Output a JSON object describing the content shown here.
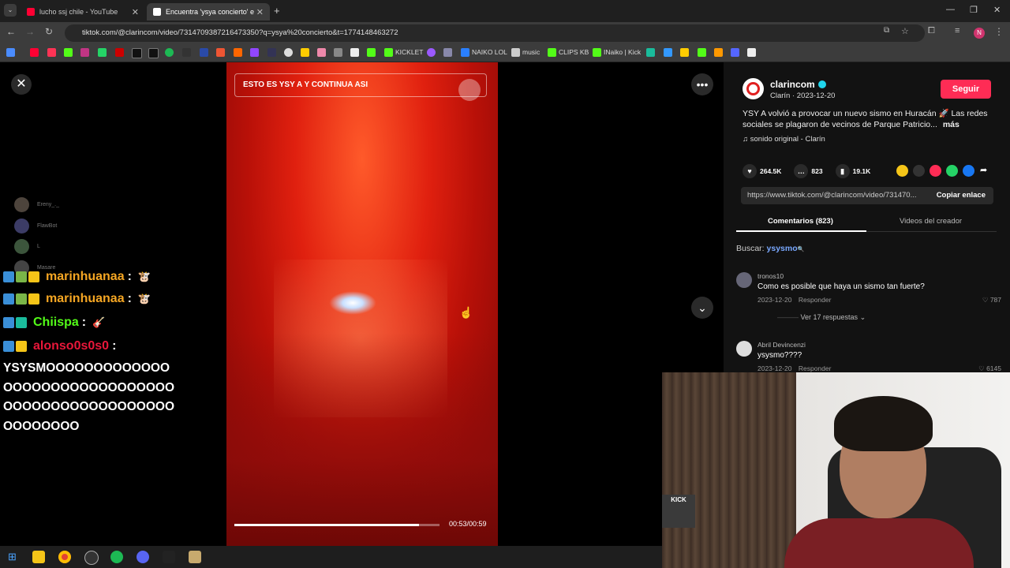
{
  "browser": {
    "tabs": [
      {
        "title": "lucho ssj chile - YouTube",
        "favicon_color": "#ff0033"
      },
      {
        "title": "Encuentra 'ysya concierto' e",
        "favicon_color": "#ffffff"
      }
    ],
    "url": "tiktok.com/@clarincom/video/7314709387216473350?q=ysya%20concierto&t=1774148463272",
    "bookmarks": [
      "KICKLET",
      "NAIKO LOL",
      "music",
      "CLIPS KB",
      "INaiko | Kick"
    ]
  },
  "stream_overlay": {
    "viewers": [
      {
        "name": "Ereny_._"
      },
      {
        "name": "FlawBot"
      },
      {
        "name": "L"
      },
      {
        "name": "Masare"
      }
    ],
    "chat": [
      {
        "user": "marinhuanaa",
        "sep": ":",
        "color": "#f5a623",
        "emote": "🐮"
      },
      {
        "user": "marinhuanaa",
        "sep": ":",
        "color": "#f5a623",
        "emote": "🐮"
      },
      {
        "user": "Chiispa",
        "sep": ":",
        "color": "#53fc18",
        "emote": "🎸"
      },
      {
        "user": "alonso0s0s0",
        "sep": ":",
        "color": "#e8173a",
        "emote": ""
      }
    ],
    "last_message": "YSYSMOOOOOOOOOOOOOOOOOOOOOOOOOOOOOOOOOOOOOOOOOOOOOOOOOOOOOOOOO"
  },
  "video": {
    "caption": "ESTO ES YSY A Y CONTINUA ASI",
    "time": "00:53/00:59",
    "progress": 0.9
  },
  "post": {
    "username": "clarincom",
    "nickname": "Clarín",
    "date": "2023-12-20",
    "follow_label": "Seguir",
    "description": "YSY A volvió a provocar un nuevo sismo en Huracán 🚀 Las redes sociales se plagaron de vecinos de Parque Patricio...",
    "more_label": "más",
    "sound": "sonido original - Clarín",
    "likes": "264.5K",
    "comments": "823",
    "saves": "19.1K",
    "link": "https://www.tiktok.com/@clarincom/video/731470...",
    "copy_label": "Copiar enlace",
    "tab_comments": "Comentarios (823)",
    "tab_creator": "Videos del creador",
    "search_prefix": "Buscar:",
    "search_term": "ysysmo"
  },
  "comments": [
    {
      "user": "tronos10",
      "text": "Como es posible que haya un sismo tan fuerte?",
      "date": "2023-12-20",
      "reply": "Responder",
      "likes": "787",
      "replies": "Ver 17 respuestas"
    },
    {
      "user": "Abril Devincenzi",
      "text": "ysysmo????",
      "date": "2023-12-20",
      "reply": "Responder",
      "likes": "6145"
    }
  ],
  "webcam": {
    "overlay_text": "KICK"
  },
  "colors": {
    "accent": "#fe2c55",
    "panel_bg": "#121212"
  }
}
